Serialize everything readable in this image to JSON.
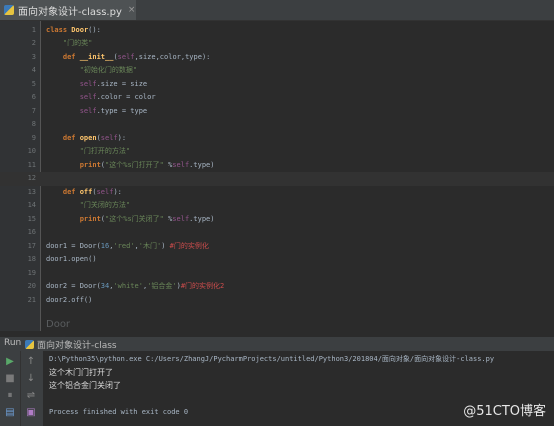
{
  "tab": {
    "title": "面向对象设计-class.py",
    "close": "×"
  },
  "editor": {
    "lines": [
      {
        "n": "1",
        "t": [
          [
            "kw",
            "class "
          ],
          [
            "fn",
            "Door"
          ],
          [
            "",
            "():"
          ]
        ]
      },
      {
        "n": "2",
        "t": [
          [
            "",
            "    "
          ],
          [
            "st",
            "\"门的类\""
          ]
        ]
      },
      {
        "n": "3",
        "t": [
          [
            "",
            "    "
          ],
          [
            "kw",
            "def "
          ],
          [
            "fn",
            "__init__"
          ],
          [
            "",
            "("
          ],
          [
            "sf",
            "self"
          ],
          [
            "",
            ",size,color,type):"
          ]
        ]
      },
      {
        "n": "4",
        "t": [
          [
            "",
            "        "
          ],
          [
            "st",
            "\"初始化门的数据\""
          ]
        ]
      },
      {
        "n": "5",
        "t": [
          [
            "",
            "        "
          ],
          [
            "sf",
            "self"
          ],
          [
            "",
            ".size = size"
          ]
        ]
      },
      {
        "n": "6",
        "t": [
          [
            "",
            "        "
          ],
          [
            "sf",
            "self"
          ],
          [
            "",
            ".color = color"
          ]
        ]
      },
      {
        "n": "7",
        "t": [
          [
            "",
            "        "
          ],
          [
            "sf",
            "self"
          ],
          [
            "",
            ".type = type"
          ]
        ]
      },
      {
        "n": "8",
        "t": [
          [
            "",
            ""
          ]
        ]
      },
      {
        "n": "9",
        "t": [
          [
            "",
            "    "
          ],
          [
            "kw",
            "def "
          ],
          [
            "fn",
            "open"
          ],
          [
            "",
            "("
          ],
          [
            "sf",
            "self"
          ],
          [
            "",
            "):"
          ]
        ]
      },
      {
        "n": "10",
        "t": [
          [
            "",
            "        "
          ],
          [
            "st",
            "\"门打开的方法\""
          ]
        ]
      },
      {
        "n": "11",
        "t": [
          [
            "",
            "        "
          ],
          [
            "kw",
            "print"
          ],
          [
            "",
            "("
          ],
          [
            "st",
            "\"这个%s门打开了\" "
          ],
          [
            "",
            "%"
          ],
          [
            "sf",
            "self"
          ],
          [
            "",
            ".type)"
          ]
        ]
      },
      {
        "n": "12",
        "t": [
          [
            "",
            ""
          ]
        ],
        "current": true
      },
      {
        "n": "13",
        "t": [
          [
            "",
            "    "
          ],
          [
            "kw",
            "def "
          ],
          [
            "fn",
            "off"
          ],
          [
            "",
            "("
          ],
          [
            "sf",
            "self"
          ],
          [
            "",
            "):"
          ]
        ]
      },
      {
        "n": "14",
        "t": [
          [
            "",
            "        "
          ],
          [
            "st",
            "\"门关闭的方法\""
          ]
        ]
      },
      {
        "n": "15",
        "t": [
          [
            "",
            "        "
          ],
          [
            "kw",
            "print"
          ],
          [
            "",
            "("
          ],
          [
            "st",
            "\"这个%s门关闭了\" "
          ],
          [
            "",
            "%"
          ],
          [
            "sf",
            "self"
          ],
          [
            "",
            ".type)"
          ]
        ]
      },
      {
        "n": "16",
        "t": [
          [
            "",
            ""
          ]
        ]
      },
      {
        "n": "17",
        "t": [
          [
            "",
            "door1 = Door("
          ],
          [
            "nm",
            "16"
          ],
          [
            "",
            ","
          ],
          [
            "st",
            "'red'"
          ],
          [
            "",
            ","
          ],
          [
            "st",
            "'木门'"
          ],
          [
            "",
            ") "
          ],
          [
            "cmt",
            "#门的实例化"
          ]
        ]
      },
      {
        "n": "18",
        "t": [
          [
            "",
            "door1.open()"
          ]
        ]
      },
      {
        "n": "19",
        "t": [
          [
            "",
            ""
          ]
        ]
      },
      {
        "n": "20",
        "t": [
          [
            "",
            "door2 = Door("
          ],
          [
            "nm",
            "34"
          ],
          [
            "",
            ","
          ],
          [
            "st",
            "'white'"
          ],
          [
            "",
            ","
          ],
          [
            "st",
            "'铝合金'"
          ],
          [
            "",
            ")"
          ],
          [
            "cmt",
            "#门的实例化2"
          ]
        ]
      },
      {
        "n": "21",
        "t": [
          [
            "",
            "door2.off()"
          ]
        ]
      }
    ],
    "breadcrumb": "Door"
  },
  "run": {
    "label": "Run",
    "name": "面向对象设计-class",
    "command": "D:\\Python35\\python.exe C:/Users/ZhangJ/PycharmProjects/untitled/Python3/201804/面向对象/面向对象设计-class.py",
    "output": [
      "这个木门门打开了",
      "这个铝合金门关闭了"
    ],
    "finish": "Process finished with exit code 0"
  },
  "watermark": "@51CTO博客",
  "colors": {
    "background": "#2b2b2b",
    "keyword": "#cc7832",
    "function": "#ffc66d",
    "string": "#6a8759",
    "self": "#94558d",
    "comment": "#cc4c4c"
  }
}
